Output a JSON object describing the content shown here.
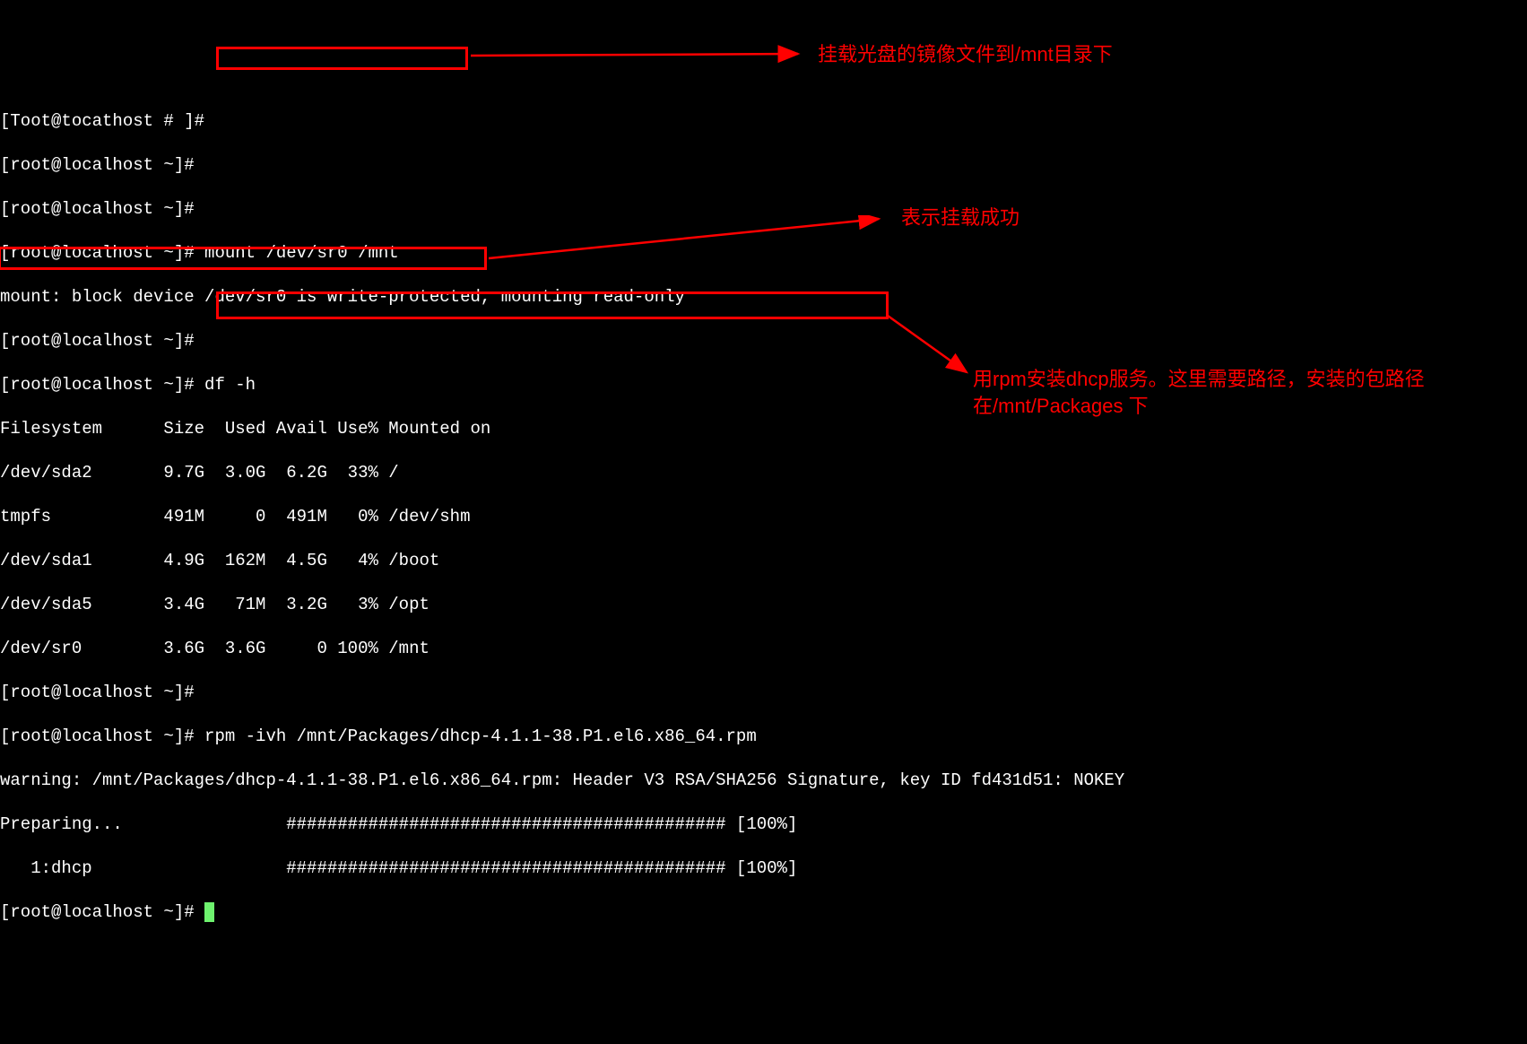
{
  "lines": {
    "l0": "[Toot@tocathost # ]#",
    "l1": "[root@localhost ~]#",
    "l2": "[root@localhost ~]#",
    "l3": "[root@localhost ~]# mount /dev/sr0 /mnt",
    "l4": "mount: block device /dev/sr0 is write-protected, mounting read-only",
    "l5": "[root@localhost ~]#",
    "l6": "[root@localhost ~]# df -h",
    "l7": "Filesystem      Size  Used Avail Use% Mounted on",
    "l8": "/dev/sda2       9.7G  3.0G  6.2G  33% /",
    "l9": "tmpfs           491M     0  491M   0% /dev/shm",
    "l10": "/dev/sda1       4.9G  162M  4.5G   4% /boot",
    "l11": "/dev/sda5       3.4G   71M  3.2G   3% /opt",
    "l12": "/dev/sr0        3.6G  3.6G     0 100% /mnt",
    "l13": "[root@localhost ~]#",
    "l14": "[root@localhost ~]# rpm -ivh /mnt/Packages/dhcp-4.1.1-38.P1.el6.x86_64.rpm",
    "l15": "warning: /mnt/Packages/dhcp-4.1.1-38.P1.el6.x86_64.rpm: Header V3 RSA/SHA256 Signature, key ID fd431d51: NOKEY",
    "l16": "Preparing...                ########################################### [100%]",
    "l17": "   1:dhcp                   ########################################### [100%]",
    "l18": "[root@localhost ~]# "
  },
  "annotations": {
    "a1": "挂载光盘的镜像文件到/mnt目录下",
    "a2": "表示挂载成功",
    "a3": "用rpm安装dhcp服务。这里需要路径，安装的包路径在/mnt/Packages 下"
  }
}
